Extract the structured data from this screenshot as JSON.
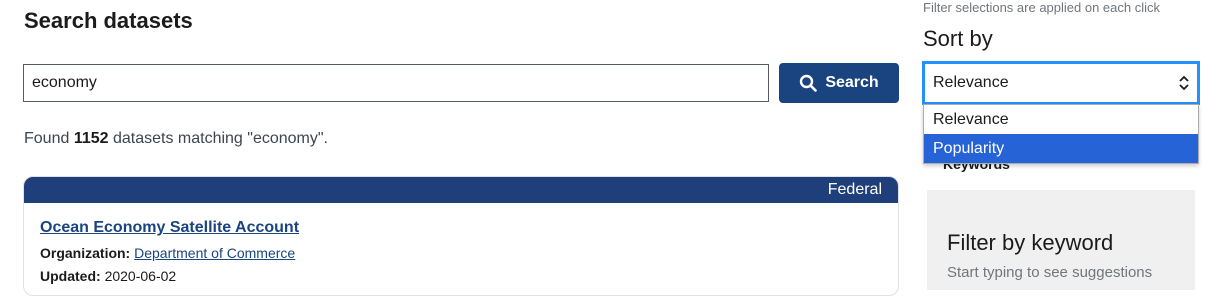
{
  "page": {
    "title": "Search datasets"
  },
  "search": {
    "value": "economy",
    "button_label": "Search"
  },
  "results": {
    "prefix": "Found ",
    "count": "1152",
    "suffix": " datasets matching \"economy\"."
  },
  "card": {
    "badge": "Federal",
    "title": "Ocean Economy Satellite Account",
    "org_label": "Organization:",
    "org_value": "Department of Commerce",
    "updated_label": "Updated:",
    "updated_value": "2020-06-02"
  },
  "sidebar": {
    "hint": "Filter selections are applied on each click",
    "sort_label": "Sort by",
    "sort_value": "Relevance",
    "sort_options": [
      "Relevance",
      "Popularity"
    ],
    "keywords_peek": "Keywords",
    "filter_title": "Filter by keyword",
    "filter_hint": "Start typing to see suggestions"
  },
  "colors": {
    "primary": "#1a4480",
    "focus": "#2491ff",
    "highlight": "#2563d6"
  },
  "icons": {
    "search": "magnifier-icon",
    "sort": "up-down-chevron-icon"
  }
}
